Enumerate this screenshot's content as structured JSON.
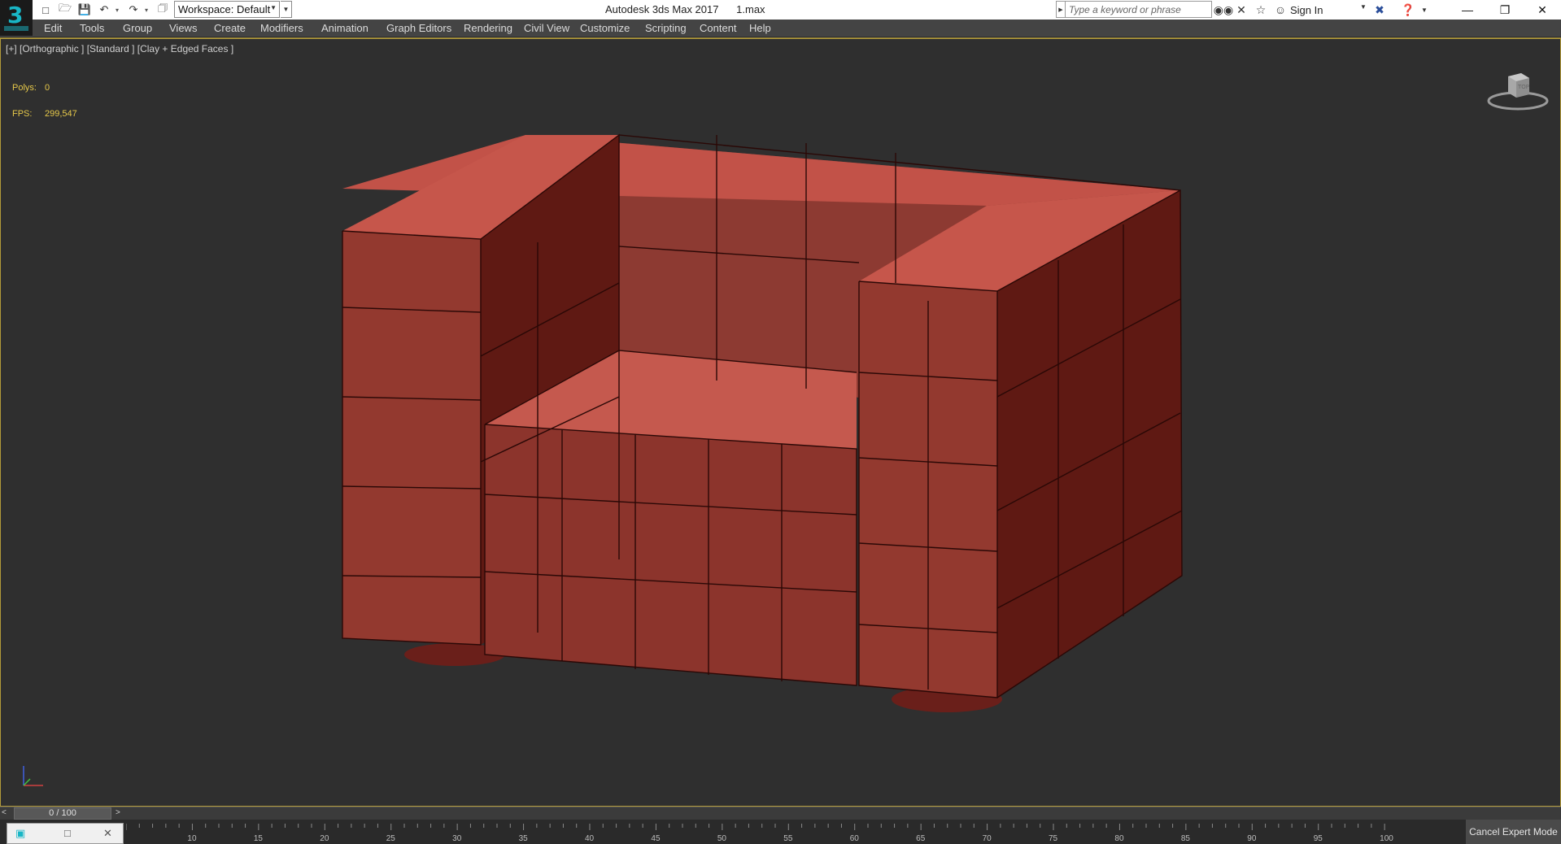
{
  "title_bar": {
    "app_icon_label": "3",
    "workspace_label": "Workspace: Default",
    "window_title": "Autodesk 3ds Max 2017      1.max",
    "search_placeholder": "Type a keyword or phrase",
    "sign_in": "Sign In",
    "quick_access_icons": [
      "new-file-icon",
      "open-file-icon",
      "save-icon",
      "undo-icon",
      "redo-icon",
      "project-icon"
    ],
    "right_icons": [
      "binoculars-icon",
      "exchange-icon",
      "favorites-star-icon",
      "user-icon",
      "x-close-app-icon",
      "help-icon"
    ]
  },
  "menu": {
    "items": [
      "Edit",
      "Tools",
      "Group",
      "Views",
      "Create",
      "Modifiers",
      "Animation",
      "Graph Editors",
      "Rendering",
      "Civil View",
      "Customize",
      "Scripting",
      "Content",
      "Help"
    ]
  },
  "viewport": {
    "label": "[+] [Orthographic ] [Standard ] [Clay + Edged Faces ]",
    "polys_label": "Polys:",
    "polys_value": "0",
    "fps_label": "FPS:",
    "fps_value": "299,547",
    "viewcube_face": "TOP",
    "object_color": "#8b3a33",
    "object_top_color": "#c4554a",
    "object_side_color": "#5e1a15",
    "axis_colors": {
      "x": "#d04040",
      "y": "#40c040",
      "z": "#4060e0"
    }
  },
  "time_slider": {
    "value": "0 / 100",
    "prev": "<",
    "next": ">"
  },
  "trackbar": {
    "ticks": [
      "10",
      "15",
      "20",
      "25",
      "30",
      "35",
      "40",
      "45",
      "50",
      "55",
      "60",
      "65",
      "70",
      "75",
      "80",
      "85",
      "90",
      "95",
      "100"
    ]
  },
  "expert_mode_button": "Cancel Expert Mode"
}
